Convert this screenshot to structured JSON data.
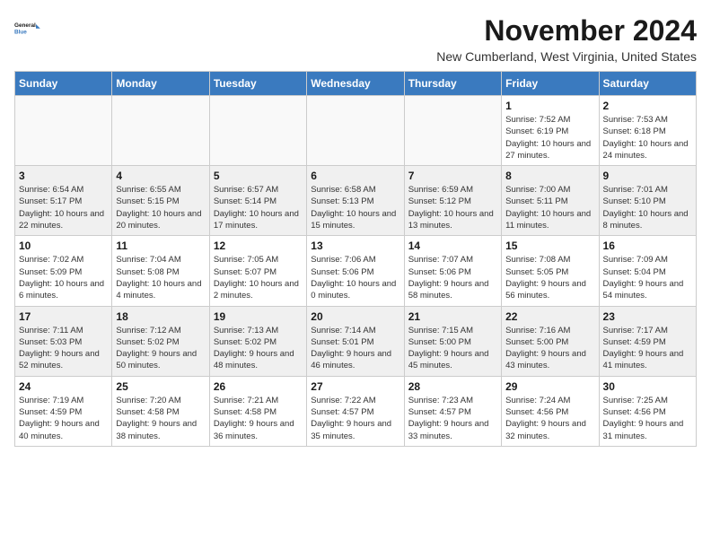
{
  "logo": {
    "line1": "General",
    "line2": "Blue"
  },
  "title": "November 2024",
  "location": "New Cumberland, West Virginia, United States",
  "days_of_week": [
    "Sunday",
    "Monday",
    "Tuesday",
    "Wednesday",
    "Thursday",
    "Friday",
    "Saturday"
  ],
  "weeks": [
    [
      {
        "day": "",
        "info": ""
      },
      {
        "day": "",
        "info": ""
      },
      {
        "day": "",
        "info": ""
      },
      {
        "day": "",
        "info": ""
      },
      {
        "day": "",
        "info": ""
      },
      {
        "day": "1",
        "info": "Sunrise: 7:52 AM\nSunset: 6:19 PM\nDaylight: 10 hours and 27 minutes."
      },
      {
        "day": "2",
        "info": "Sunrise: 7:53 AM\nSunset: 6:18 PM\nDaylight: 10 hours and 24 minutes."
      }
    ],
    [
      {
        "day": "3",
        "info": "Sunrise: 6:54 AM\nSunset: 5:17 PM\nDaylight: 10 hours and 22 minutes."
      },
      {
        "day": "4",
        "info": "Sunrise: 6:55 AM\nSunset: 5:15 PM\nDaylight: 10 hours and 20 minutes."
      },
      {
        "day": "5",
        "info": "Sunrise: 6:57 AM\nSunset: 5:14 PM\nDaylight: 10 hours and 17 minutes."
      },
      {
        "day": "6",
        "info": "Sunrise: 6:58 AM\nSunset: 5:13 PM\nDaylight: 10 hours and 15 minutes."
      },
      {
        "day": "7",
        "info": "Sunrise: 6:59 AM\nSunset: 5:12 PM\nDaylight: 10 hours and 13 minutes."
      },
      {
        "day": "8",
        "info": "Sunrise: 7:00 AM\nSunset: 5:11 PM\nDaylight: 10 hours and 11 minutes."
      },
      {
        "day": "9",
        "info": "Sunrise: 7:01 AM\nSunset: 5:10 PM\nDaylight: 10 hours and 8 minutes."
      }
    ],
    [
      {
        "day": "10",
        "info": "Sunrise: 7:02 AM\nSunset: 5:09 PM\nDaylight: 10 hours and 6 minutes."
      },
      {
        "day": "11",
        "info": "Sunrise: 7:04 AM\nSunset: 5:08 PM\nDaylight: 10 hours and 4 minutes."
      },
      {
        "day": "12",
        "info": "Sunrise: 7:05 AM\nSunset: 5:07 PM\nDaylight: 10 hours and 2 minutes."
      },
      {
        "day": "13",
        "info": "Sunrise: 7:06 AM\nSunset: 5:06 PM\nDaylight: 10 hours and 0 minutes."
      },
      {
        "day": "14",
        "info": "Sunrise: 7:07 AM\nSunset: 5:06 PM\nDaylight: 9 hours and 58 minutes."
      },
      {
        "day": "15",
        "info": "Sunrise: 7:08 AM\nSunset: 5:05 PM\nDaylight: 9 hours and 56 minutes."
      },
      {
        "day": "16",
        "info": "Sunrise: 7:09 AM\nSunset: 5:04 PM\nDaylight: 9 hours and 54 minutes."
      }
    ],
    [
      {
        "day": "17",
        "info": "Sunrise: 7:11 AM\nSunset: 5:03 PM\nDaylight: 9 hours and 52 minutes."
      },
      {
        "day": "18",
        "info": "Sunrise: 7:12 AM\nSunset: 5:02 PM\nDaylight: 9 hours and 50 minutes."
      },
      {
        "day": "19",
        "info": "Sunrise: 7:13 AM\nSunset: 5:02 PM\nDaylight: 9 hours and 48 minutes."
      },
      {
        "day": "20",
        "info": "Sunrise: 7:14 AM\nSunset: 5:01 PM\nDaylight: 9 hours and 46 minutes."
      },
      {
        "day": "21",
        "info": "Sunrise: 7:15 AM\nSunset: 5:00 PM\nDaylight: 9 hours and 45 minutes."
      },
      {
        "day": "22",
        "info": "Sunrise: 7:16 AM\nSunset: 5:00 PM\nDaylight: 9 hours and 43 minutes."
      },
      {
        "day": "23",
        "info": "Sunrise: 7:17 AM\nSunset: 4:59 PM\nDaylight: 9 hours and 41 minutes."
      }
    ],
    [
      {
        "day": "24",
        "info": "Sunrise: 7:19 AM\nSunset: 4:59 PM\nDaylight: 9 hours and 40 minutes."
      },
      {
        "day": "25",
        "info": "Sunrise: 7:20 AM\nSunset: 4:58 PM\nDaylight: 9 hours and 38 minutes."
      },
      {
        "day": "26",
        "info": "Sunrise: 7:21 AM\nSunset: 4:58 PM\nDaylight: 9 hours and 36 minutes."
      },
      {
        "day": "27",
        "info": "Sunrise: 7:22 AM\nSunset: 4:57 PM\nDaylight: 9 hours and 35 minutes."
      },
      {
        "day": "28",
        "info": "Sunrise: 7:23 AM\nSunset: 4:57 PM\nDaylight: 9 hours and 33 minutes."
      },
      {
        "day": "29",
        "info": "Sunrise: 7:24 AM\nSunset: 4:56 PM\nDaylight: 9 hours and 32 minutes."
      },
      {
        "day": "30",
        "info": "Sunrise: 7:25 AM\nSunset: 4:56 PM\nDaylight: 9 hours and 31 minutes."
      }
    ]
  ]
}
